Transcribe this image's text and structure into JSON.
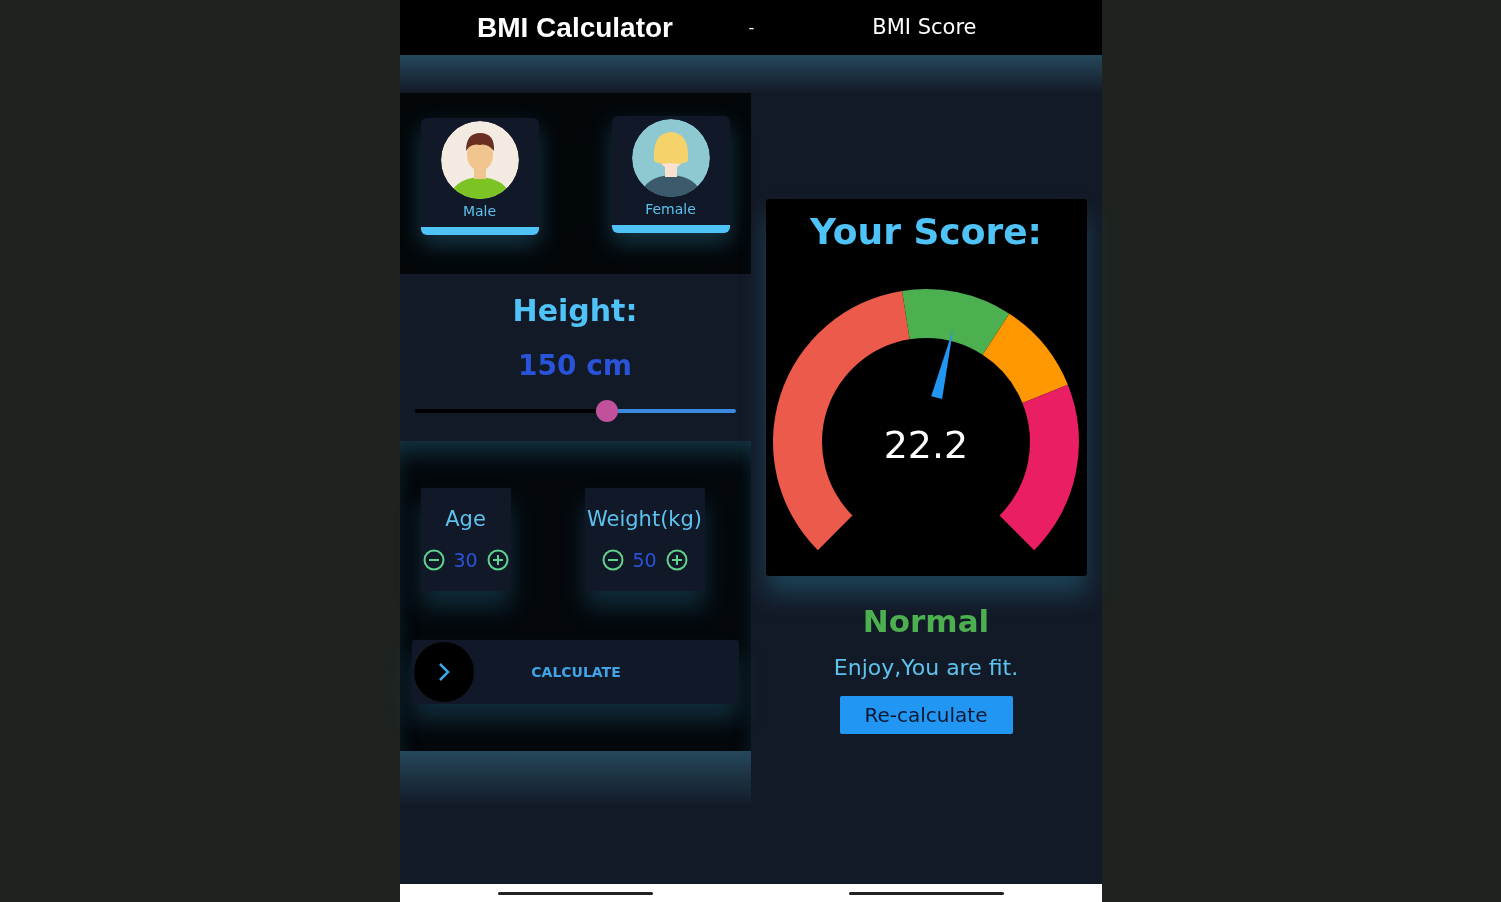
{
  "app_bar": {
    "title": "BMI Calculator",
    "separator": "-",
    "subtitle": "BMI Score"
  },
  "genders": [
    {
      "kind": "male",
      "label": "Male"
    },
    {
      "kind": "female",
      "label": "Female"
    }
  ],
  "height": {
    "label": "Height:",
    "value": "150 cm",
    "level": 0.6
  },
  "counters": [
    {
      "label": "Age",
      "value": "30"
    },
    {
      "label": "Weight(kg)",
      "value": "50"
    }
  ],
  "calculate_button": "CALCULATE",
  "score": {
    "title": "Your Score:",
    "value": "22.2",
    "level": 0.55,
    "segments": [
      {
        "color": "#eb5a4b"
      },
      {
        "color": "#4caf50"
      },
      {
        "color": "#ff9800"
      },
      {
        "color": "#e91e63"
      }
    ]
  },
  "category": "Normal",
  "message": "Enjoy,You are fit.",
  "recalculate_button": "Re-calculate"
}
